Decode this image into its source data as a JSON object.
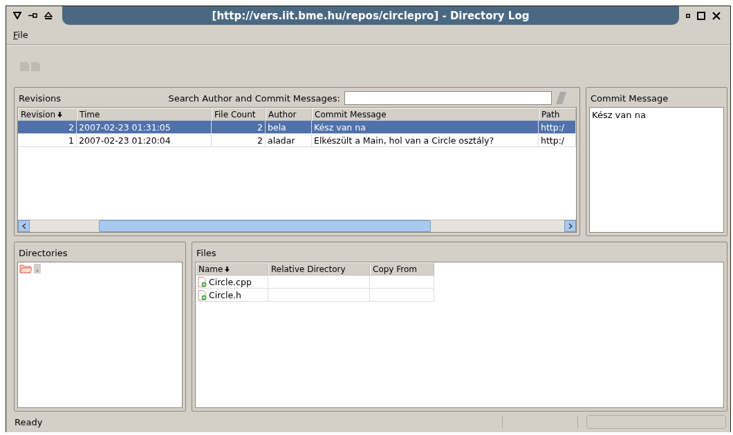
{
  "window": {
    "title": "[http://vers.iit.bme.hu/repos/circlepro] - Directory Log"
  },
  "menu": [
    {
      "label": "File"
    }
  ],
  "revisions": {
    "title": "Revisions",
    "search_label": "Search Author and Commit Messages:",
    "columns": [
      {
        "label": "Revision",
        "sorted": true
      },
      {
        "label": "Time",
        "sorted": false
      },
      {
        "label": "File Count",
        "sorted": false
      },
      {
        "label": "Author",
        "sorted": false
      },
      {
        "label": "Commit Message",
        "sorted": false
      },
      {
        "label": "Path",
        "sorted": false
      }
    ],
    "rows": [
      {
        "selected": true,
        "cells": [
          "2",
          "2007-02-23 01:31:05",
          "2",
          "bela",
          "Kész van na",
          "http:/"
        ]
      },
      {
        "selected": false,
        "cells": [
          "1",
          "2007-02-23 01:20:04",
          "2",
          "aladar",
          "Elkészült a Main, hol van a Circle osztály?",
          "http:/"
        ]
      }
    ]
  },
  "commit_message": {
    "title": "Commit Message",
    "text": "Kész van na"
  },
  "directories": {
    "title": "Directories",
    "items": [
      {
        "label": ".",
        "selected": true
      }
    ]
  },
  "files": {
    "title": "Files",
    "columns": [
      {
        "label": "Name",
        "sorted": true
      },
      {
        "label": "Relative Directory",
        "sorted": false
      },
      {
        "label": "Copy From",
        "sorted": false
      }
    ],
    "rows": [
      {
        "name": "Circle.cpp"
      },
      {
        "name": "Circle.h"
      }
    ]
  },
  "status_bar": {
    "text": "Ready"
  }
}
